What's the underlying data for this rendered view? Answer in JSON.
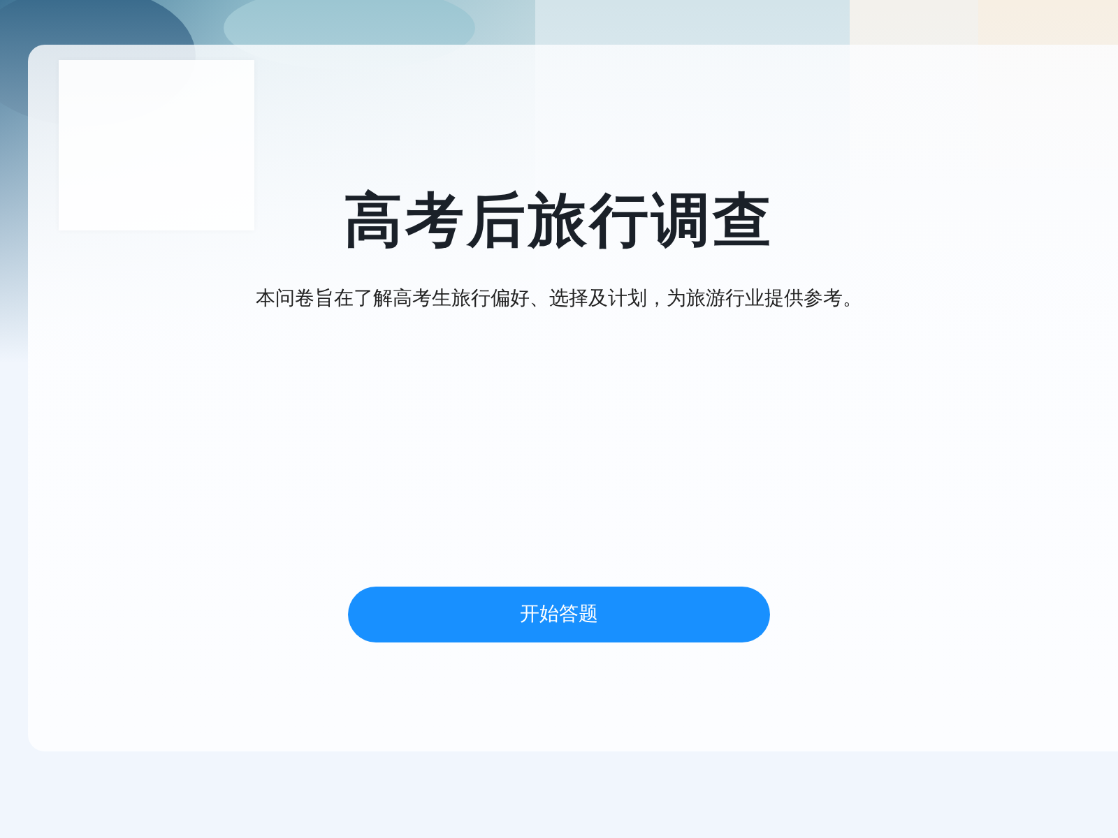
{
  "survey": {
    "title": "高考后旅行调查",
    "description": "本问卷旨在了解高考生旅行偏好、选择及计划，为旅游行业提供参考。",
    "start_button": "开始答题"
  }
}
